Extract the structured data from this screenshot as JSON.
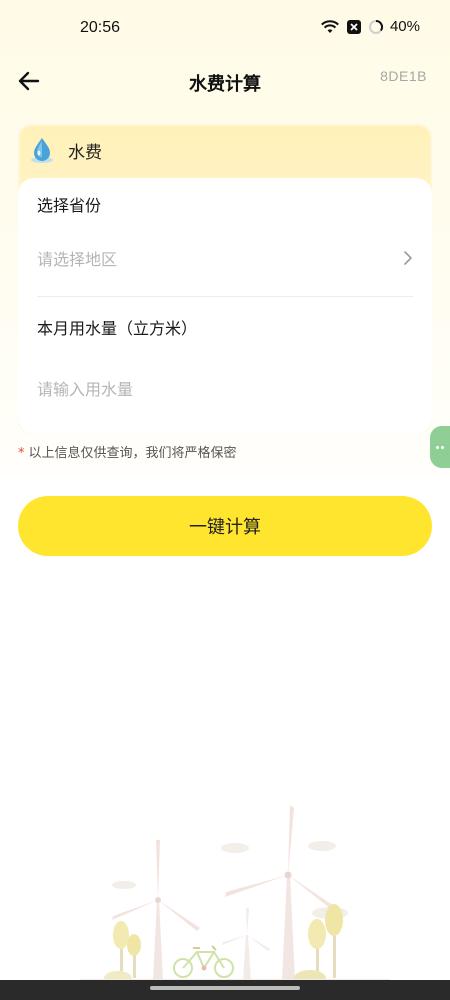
{
  "status_bar": {
    "time": "20:56",
    "battery": "40%",
    "icons": [
      "wifi-icon",
      "notification-close-icon",
      "battery-ring-icon"
    ]
  },
  "header": {
    "title": "水费计算",
    "code": "8DE1B",
    "back_icon": "arrow-left-icon"
  },
  "card": {
    "title": "水费",
    "icon": "water-drop-icon",
    "province": {
      "label": "选择省份",
      "placeholder": "请选择地区"
    },
    "usage": {
      "label": "本月用水量（立方米）",
      "placeholder": "请输入用水量"
    }
  },
  "notice": {
    "star": "*",
    "text": "以上信息仅供查询，我们将严格保密"
  },
  "button": {
    "label": "一键计算"
  },
  "colors": {
    "accent": "#ffe52e",
    "card_header": "#fff1b8",
    "side_tab": "#8fcf96",
    "notice_star": "#e5483b"
  }
}
